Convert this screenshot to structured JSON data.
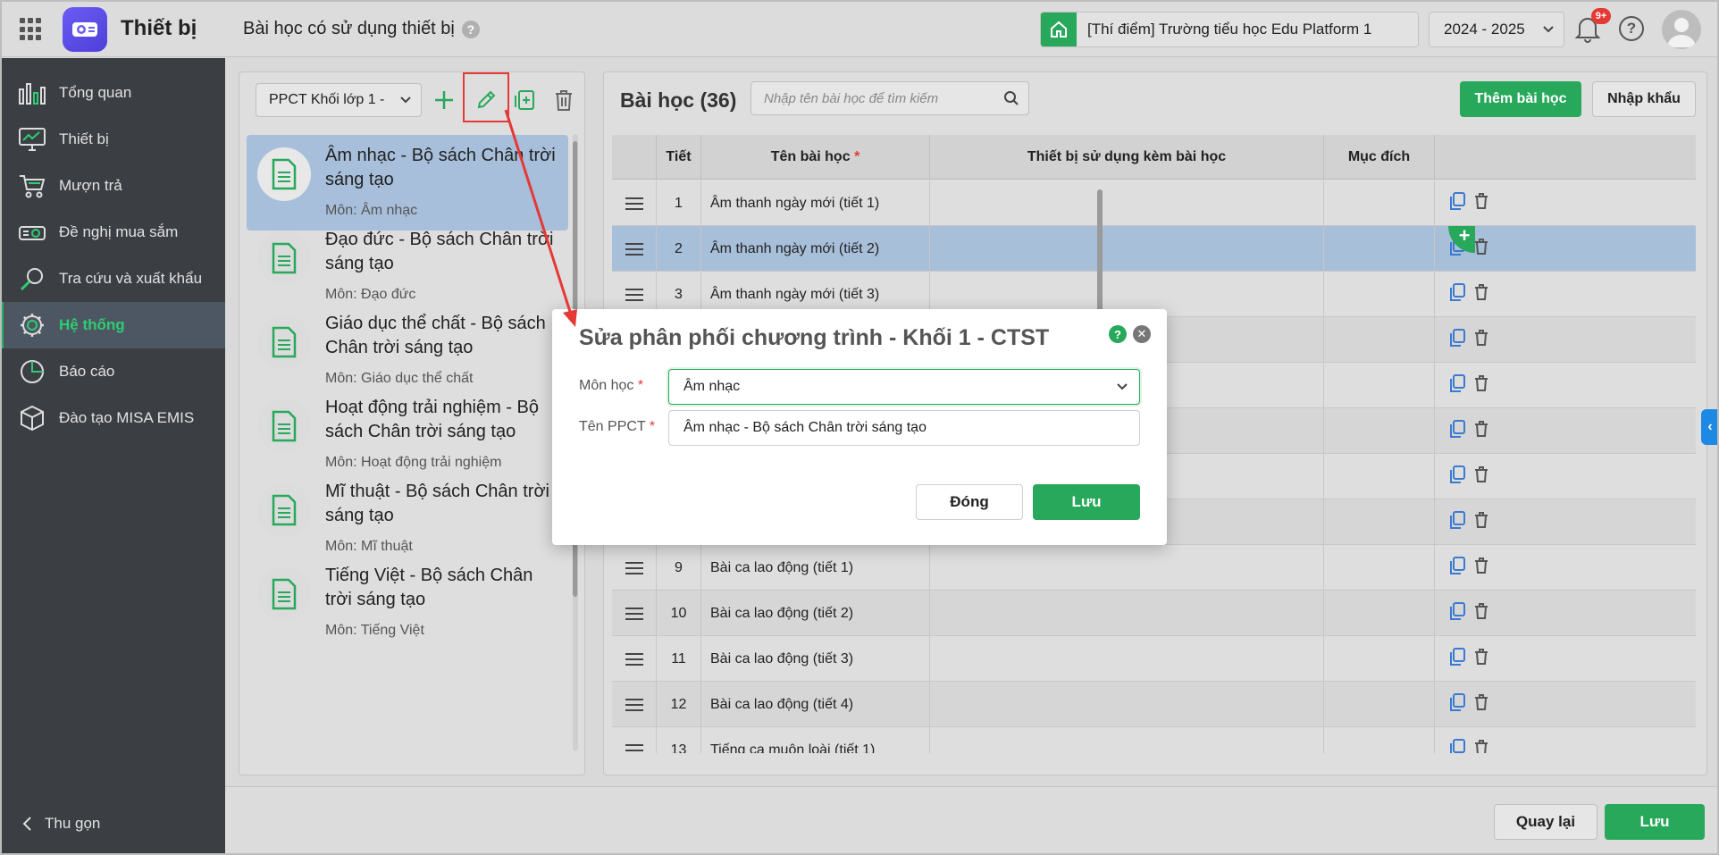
{
  "app": {
    "title": "Thiết bị",
    "page_title": "Bài học có sử dụng thiết bị",
    "help_glyph": "?"
  },
  "header": {
    "school": "[Thí điểm] Trường tiểu học Edu Platform 1",
    "year": "2024 - 2025",
    "notification_count": "9+"
  },
  "sidebar": {
    "items": [
      {
        "label": "Tổng quan",
        "icon": "bar-chart-icon"
      },
      {
        "label": "Thiết bị",
        "icon": "monitor-icon"
      },
      {
        "label": "Mượn trả",
        "icon": "cart-icon"
      },
      {
        "label": "Đề nghị mua sắm",
        "icon": "projector-icon"
      },
      {
        "label": "Tra cứu và xuất khẩu",
        "icon": "search-icon"
      },
      {
        "label": "Hệ thống",
        "icon": "gear-icon",
        "active": true
      },
      {
        "label": "Báo cáo",
        "icon": "pie-chart-icon"
      },
      {
        "label": "Đào tạo MISA EMIS",
        "icon": "cube-icon"
      }
    ],
    "collapse_label": "Thu gọn"
  },
  "left_panel": {
    "select_value": "PPCT Khối lớp 1 -",
    "items": [
      {
        "title": "Âm nhạc - Bộ sách Chân trời sáng tạo",
        "subject": "Môn: Âm nhạc",
        "selected": true
      },
      {
        "title": "Đạo đức - Bộ sách Chân trời sáng tạo",
        "subject": "Môn: Đạo đức"
      },
      {
        "title": "Giáo dục thể chất - Bộ sách Chân trời sáng tạo",
        "subject": "Môn: Giáo dục thể chất"
      },
      {
        "title": "Hoạt động trải nghiệm - Bộ sách Chân trời sáng tạo",
        "subject": "Môn: Hoạt động trải nghiệm"
      },
      {
        "title": "Mĩ thuật - Bộ sách Chân trời sáng tạo",
        "subject": "Môn: Mĩ thuật"
      },
      {
        "title": "Tiếng Việt - Bộ sách Chân trời sáng tạo",
        "subject": "Môn: Tiếng Việt"
      }
    ]
  },
  "right_panel": {
    "title": "Bài học (36)",
    "search_placeholder": "Nhập tên bài học để tìm kiếm",
    "add_label": "Thêm bài học",
    "import_label": "Nhập khẩu",
    "columns": {
      "tiet": "Tiết",
      "ten": "Tên bài học",
      "required_mark": "*",
      "thiet_bi": "Thiết bị sử dụng kèm bài học",
      "muc_dich": "Mục đích"
    },
    "rows": [
      {
        "tiet": "1",
        "ten": "Âm thanh ngày mới (tiết 1)"
      },
      {
        "tiet": "2",
        "ten": "Âm thanh ngày mới (tiết 2)",
        "highlight": true
      },
      {
        "tiet": "3",
        "ten": "Âm thanh ngày mới (tiết 3)"
      },
      {
        "tiet": "",
        "ten": ""
      },
      {
        "tiet": "",
        "ten": ""
      },
      {
        "tiet": "",
        "ten": ""
      },
      {
        "tiet": "",
        "ten": ""
      },
      {
        "tiet": "",
        "ten": ""
      },
      {
        "tiet": "9",
        "ten": "Bài ca lao động (tiết 1)"
      },
      {
        "tiet": "10",
        "ten": "Bài ca lao động (tiết 2)"
      },
      {
        "tiet": "11",
        "ten": "Bài ca lao động (tiết 3)"
      },
      {
        "tiet": "12",
        "ten": "Bài ca lao động (tiết 4)"
      },
      {
        "tiet": "13",
        "ten": "Tiếng ca muôn loài (tiết 1)"
      }
    ]
  },
  "footer": {
    "back_label": "Quay lại",
    "save_label": "Lưu"
  },
  "modal": {
    "title": "Sửa phân phối chương trình - Khối 1 - CTST",
    "subject_label": "Môn học",
    "subject_value": "Âm nhạc",
    "name_label": "Tên PPCT",
    "name_value": "Âm nhạc - Bộ sách Chân trời sáng tạo",
    "required_mark": "*",
    "help_glyph": "?",
    "close_glyph": "✕",
    "close_label": "Đóng",
    "save_label": "Lưu"
  },
  "colors": {
    "accent": "#27a85a",
    "highlight": "#a8bfda",
    "annotation": "#e53935"
  }
}
